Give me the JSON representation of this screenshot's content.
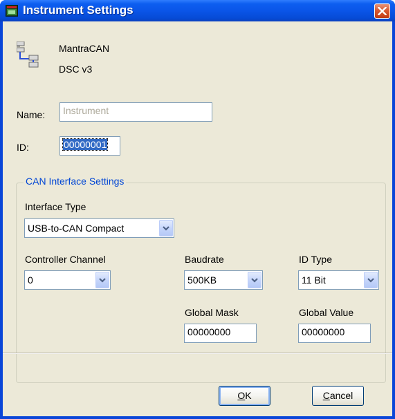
{
  "window": {
    "title": "Instrument Settings"
  },
  "device": {
    "name": "MantraCAN",
    "version": "DSC v3"
  },
  "fields": {
    "name_label": "Name:",
    "name_value": "Instrument",
    "id_label": "ID:",
    "id_value": "00000001"
  },
  "can_group": {
    "title": "CAN Interface Settings",
    "interface_type_label": "Interface Type",
    "interface_type_value": "USB-to-CAN Compact",
    "controller_channel_label": "Controller Channel",
    "controller_channel_value": "0",
    "baudrate_label": "Baudrate",
    "baudrate_value": "500KB",
    "id_type_label": "ID Type",
    "id_type_value": "11 Bit",
    "global_mask_label": "Global Mask",
    "global_mask_value": "00000000",
    "global_value_label": "Global Value",
    "global_value_value": "00000000"
  },
  "buttons": {
    "ok_mnemonic": "O",
    "ok_rest": "K",
    "cancel_mnemonic": "C",
    "cancel_rest": "ancel"
  },
  "colors": {
    "titlebar": "#0a55e8",
    "dialog_bg": "#ece9d8",
    "group_title": "#0046d5",
    "selection": "#316ac5",
    "close_button": "#d95a32"
  }
}
